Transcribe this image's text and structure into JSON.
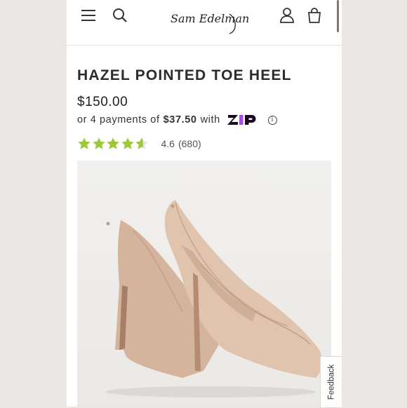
{
  "header": {
    "menu_icon": "hamburger-menu-icon",
    "search_icon": "search-icon",
    "logo_text": "Sam Edelman",
    "account_icon": "user-icon",
    "cart_icon": "shopping-bag-icon"
  },
  "product": {
    "title": "HAZEL POINTED TOE HEEL",
    "price": "$150.00",
    "installments": {
      "prefix": "or 4 payments of",
      "amount": "$37.50",
      "suffix": "with",
      "provider": "Zip",
      "info_icon": "info-icon"
    },
    "rating": {
      "stars": 4.6,
      "value": "4.6",
      "count": "(680)",
      "star_color": "#9bc93a"
    },
    "image_alt": "Nude suede pointed toe pumps"
  },
  "feedback": {
    "label": "Feedback"
  },
  "colors": {
    "zip_purple": "#1a0826",
    "star_green": "#9bc93a",
    "suede": "#d9bca5"
  }
}
